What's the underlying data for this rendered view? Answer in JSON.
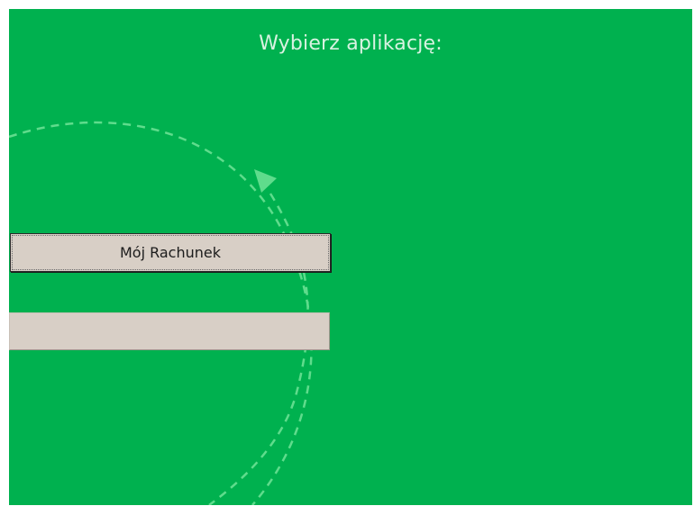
{
  "screen": {
    "heading": "Wybierz aplikację:",
    "background_color": "#00b14f"
  },
  "decor": {
    "arrow_icon": "triangle-up-icon",
    "circle_style": "dashed"
  },
  "apps": [
    {
      "label": "Mój Rachunek",
      "focused": true
    },
    {
      "label": "",
      "focused": false
    }
  ]
}
